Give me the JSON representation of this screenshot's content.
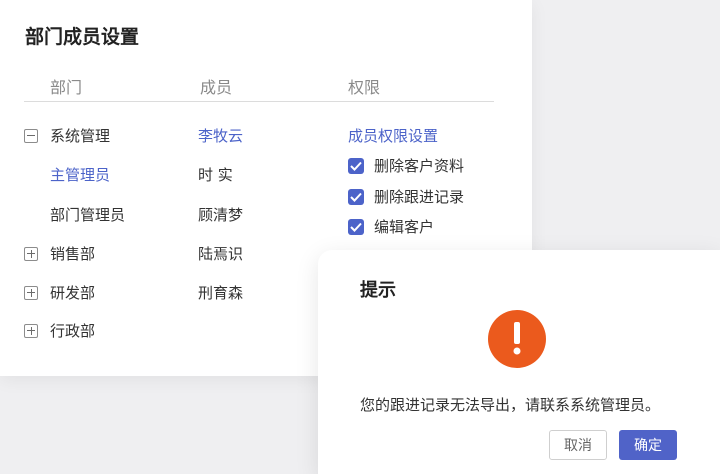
{
  "panel": {
    "title": "部门成员设置",
    "columns": {
      "department": "部门",
      "member": "成员",
      "permission": "权限"
    },
    "departments": [
      {
        "label": "系统管理",
        "expander": "minus-square-icon"
      },
      {
        "label": "主管理员",
        "selected": true
      },
      {
        "label": "部门管理员"
      },
      {
        "label": "销售部",
        "expander": "plus-square-icon"
      },
      {
        "label": "研发部",
        "expander": "plus-square-icon"
      },
      {
        "label": "行政部",
        "expander": "plus-square-icon"
      }
    ],
    "members": [
      "李牧云",
      "时 实",
      "顾清梦",
      "陆焉识",
      "刑育森"
    ],
    "permission_title": "成员权限设置",
    "permissions": [
      {
        "label": "删除客户资料",
        "checked": true
      },
      {
        "label": "删除跟进记录",
        "checked": true
      },
      {
        "label": "编辑客户",
        "checked": true
      }
    ]
  },
  "dialog": {
    "title": "提示",
    "icon": "exclamation-circle-icon",
    "message": "您的跟进记录无法导出，请联系系统管理员。",
    "cancel_label": "取消",
    "ok_label": "确定"
  },
  "colors": {
    "accent": "#4c63c9",
    "alert": "#eb5a1d",
    "primary_button": "#5063c8"
  }
}
